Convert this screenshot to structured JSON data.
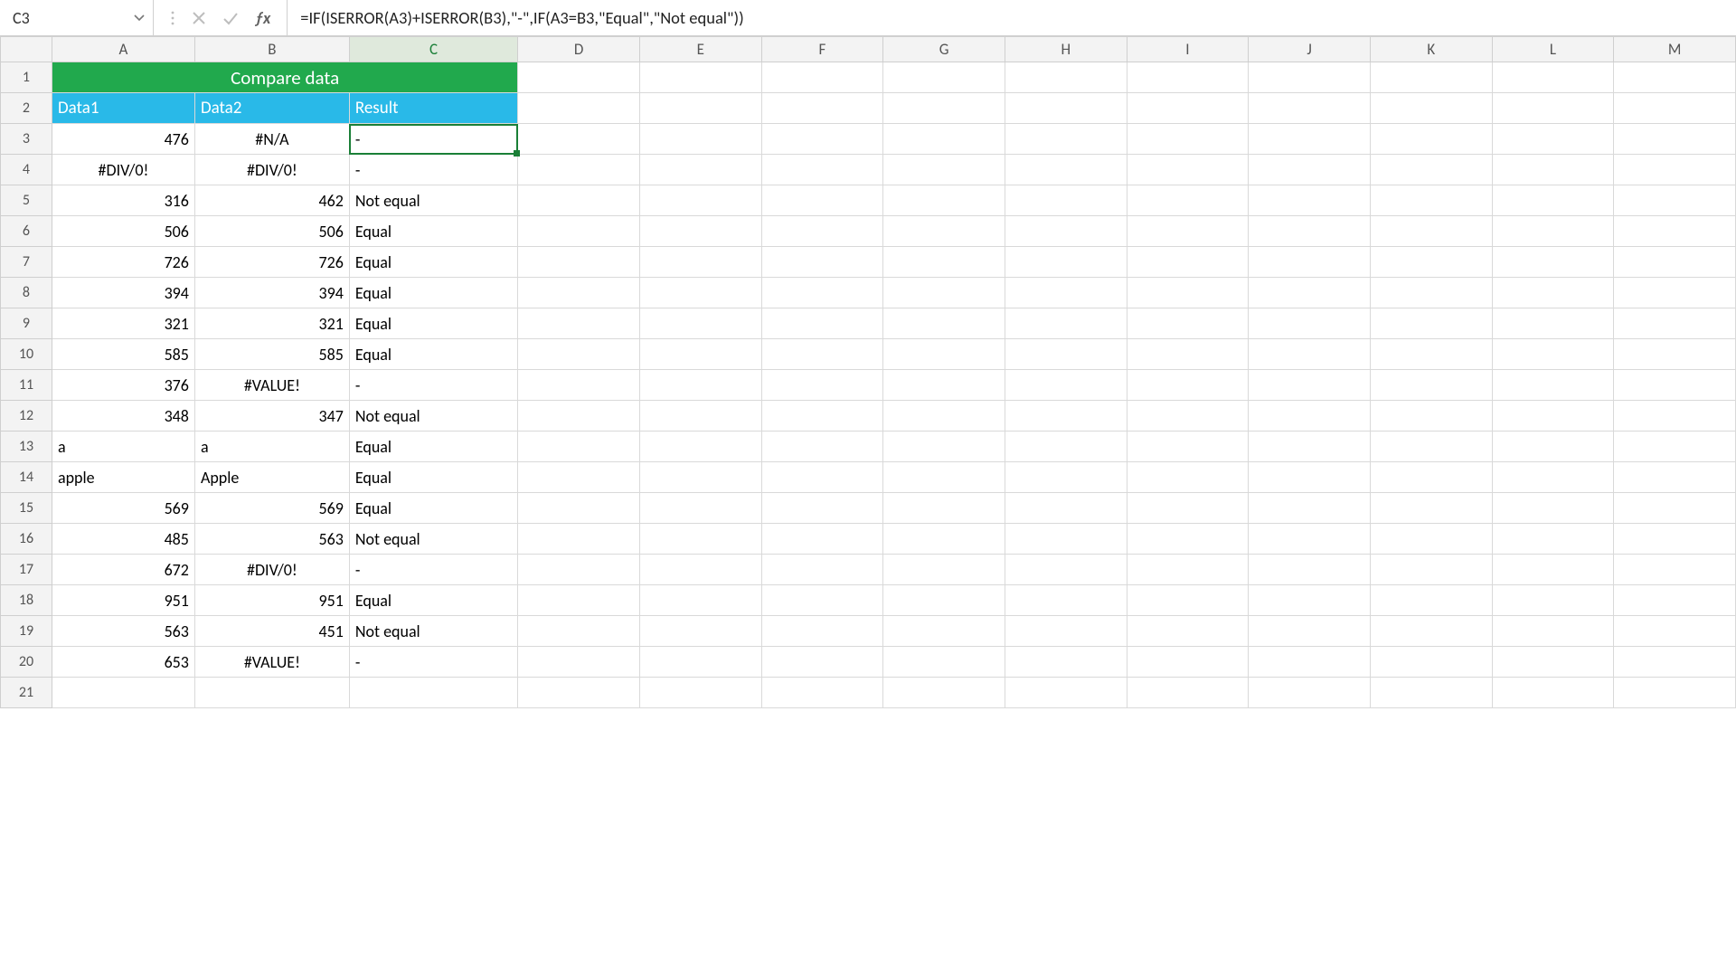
{
  "nameBox": "C3",
  "formula": "=IF(ISERROR(A3)+ISERROR(B3),\"-\",IF(A3=B3,\"Equal\",\"Not equal\"))",
  "columns": [
    "A",
    "B",
    "C",
    "D",
    "E",
    "F",
    "G",
    "H",
    "I",
    "J",
    "K",
    "L",
    "M"
  ],
  "mergedTitle": "Compare data",
  "subHeaders": {
    "a": "Data1",
    "b": "Data2",
    "c": "Result"
  },
  "rows": [
    {
      "n": 3,
      "a": "476",
      "aAlign": "num",
      "b": "#N/A",
      "bAlign": "ctr",
      "c": "-",
      "cAlign": "txt"
    },
    {
      "n": 4,
      "a": "#DIV/0!",
      "aAlign": "ctr",
      "b": "#DIV/0!",
      "bAlign": "ctr",
      "c": "-",
      "cAlign": "txt"
    },
    {
      "n": 5,
      "a": "316",
      "aAlign": "num",
      "b": "462",
      "bAlign": "num",
      "c": "Not equal",
      "cAlign": "txt"
    },
    {
      "n": 6,
      "a": "506",
      "aAlign": "num",
      "b": "506",
      "bAlign": "num",
      "c": "Equal",
      "cAlign": "txt"
    },
    {
      "n": 7,
      "a": "726",
      "aAlign": "num",
      "b": "726",
      "bAlign": "num",
      "c": "Equal",
      "cAlign": "txt"
    },
    {
      "n": 8,
      "a": "394",
      "aAlign": "num",
      "b": "394",
      "bAlign": "num",
      "c": "Equal",
      "cAlign": "txt"
    },
    {
      "n": 9,
      "a": "321",
      "aAlign": "num",
      "b": "321",
      "bAlign": "num",
      "c": "Equal",
      "cAlign": "txt"
    },
    {
      "n": 10,
      "a": "585",
      "aAlign": "num",
      "b": "585",
      "bAlign": "num",
      "c": "Equal",
      "cAlign": "txt"
    },
    {
      "n": 11,
      "a": "376",
      "aAlign": "num",
      "b": "#VALUE!",
      "bAlign": "ctr",
      "c": "-",
      "cAlign": "txt"
    },
    {
      "n": 12,
      "a": "348",
      "aAlign": "num",
      "b": "347",
      "bAlign": "num",
      "c": "Not equal",
      "cAlign": "txt"
    },
    {
      "n": 13,
      "a": "a",
      "aAlign": "txt",
      "b": "a",
      "bAlign": "txt",
      "c": "Equal",
      "cAlign": "txt"
    },
    {
      "n": 14,
      "a": "apple",
      "aAlign": "txt",
      "b": "Apple",
      "bAlign": "txt",
      "c": "Equal",
      "cAlign": "txt"
    },
    {
      "n": 15,
      "a": "569",
      "aAlign": "num",
      "b": "569",
      "bAlign": "num",
      "c": "Equal",
      "cAlign": "txt"
    },
    {
      "n": 16,
      "a": "485",
      "aAlign": "num",
      "b": "563",
      "bAlign": "num",
      "c": "Not equal",
      "cAlign": "txt"
    },
    {
      "n": 17,
      "a": "672",
      "aAlign": "num",
      "b": "#DIV/0!",
      "bAlign": "ctr",
      "c": "-",
      "cAlign": "txt"
    },
    {
      "n": 18,
      "a": "951",
      "aAlign": "num",
      "b": "951",
      "bAlign": "num",
      "c": "Equal",
      "cAlign": "txt"
    },
    {
      "n": 19,
      "a": "563",
      "aAlign": "num",
      "b": "451",
      "bAlign": "num",
      "c": "Not equal",
      "cAlign": "txt"
    },
    {
      "n": 20,
      "a": "653",
      "aAlign": "num",
      "b": "#VALUE!",
      "bAlign": "ctr",
      "c": "-",
      "cAlign": "txt"
    },
    {
      "n": 21,
      "a": "",
      "aAlign": "txt",
      "b": "",
      "bAlign": "txt",
      "c": "",
      "cAlign": "txt"
    }
  ],
  "selected": {
    "row": 3,
    "col": "C"
  }
}
